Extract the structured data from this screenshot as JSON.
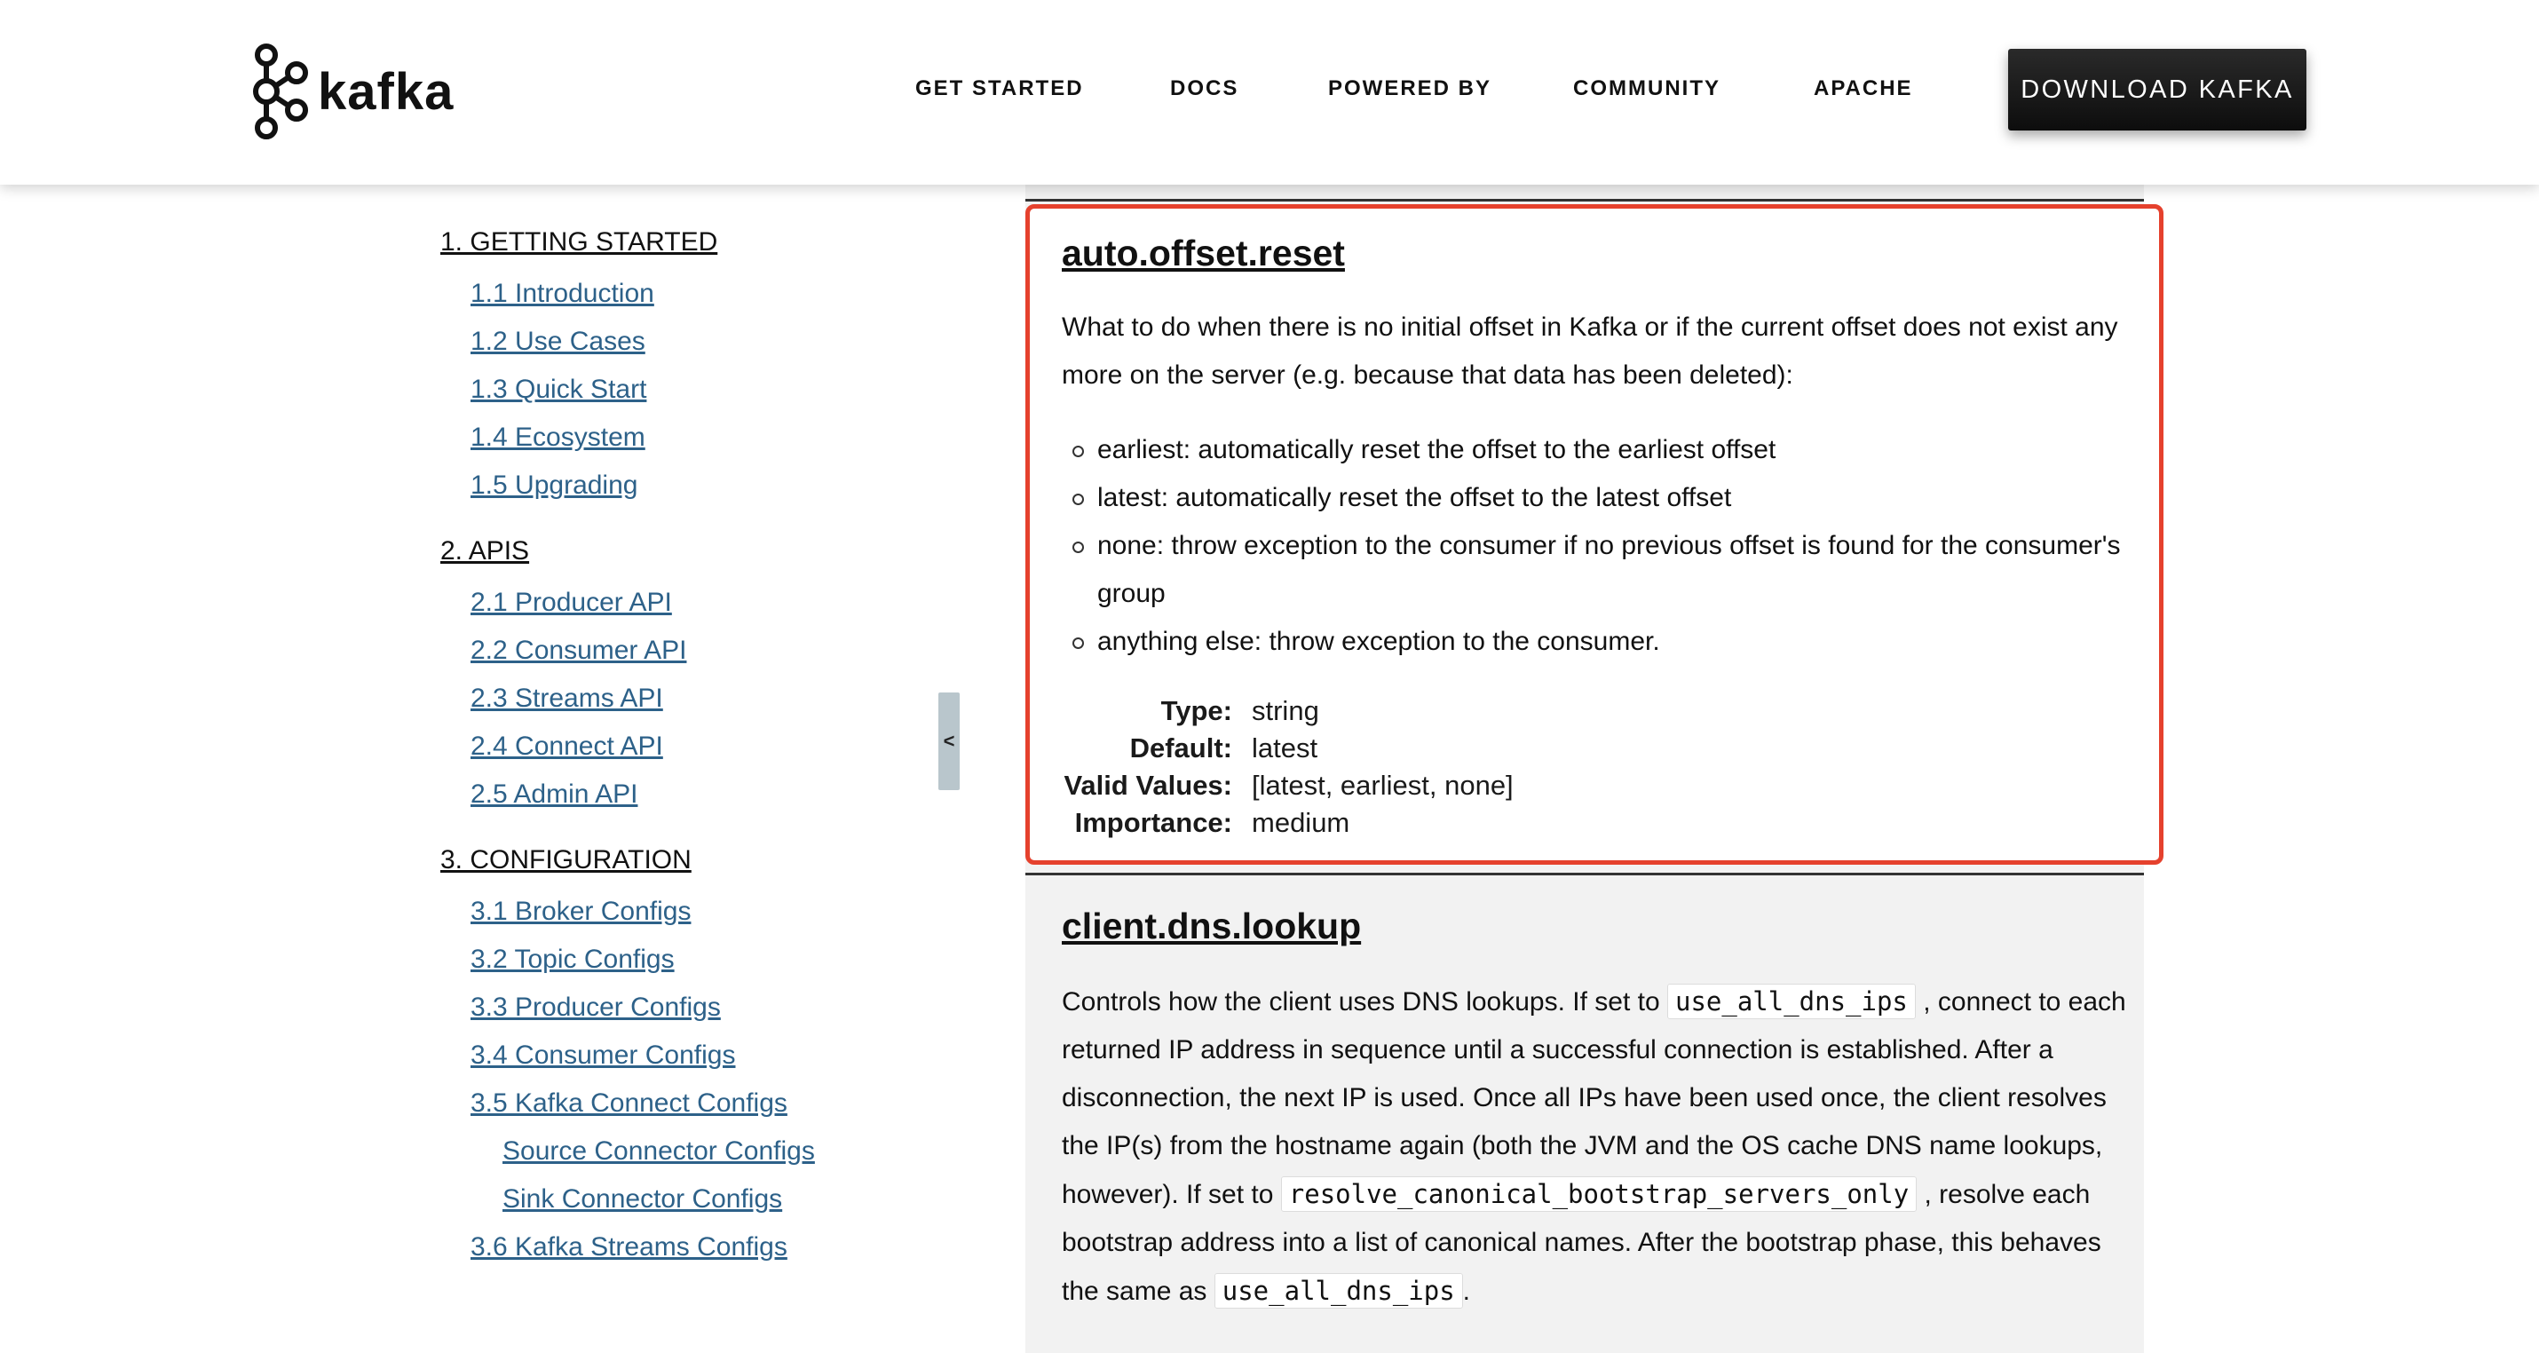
{
  "header": {
    "logo_text": "kafka",
    "nav": [
      "GET STARTED",
      "DOCS",
      "POWERED BY",
      "COMMUNITY",
      "APACHE"
    ],
    "download_label": "DOWNLOAD KAFKA"
  },
  "sidebar": {
    "sections": [
      {
        "label": "1. GETTING STARTED",
        "items": [
          "1.1 Introduction",
          "1.2 Use Cases",
          "1.3 Quick Start",
          "1.4 Ecosystem",
          "1.5 Upgrading"
        ]
      },
      {
        "label": "2. APIS",
        "items": [
          "2.1 Producer API",
          "2.2 Consumer API",
          "2.3 Streams API",
          "2.4 Connect API",
          "2.5 Admin API"
        ]
      },
      {
        "label": "3. CONFIGURATION",
        "items": [
          "3.1 Broker Configs",
          "3.2 Topic Configs",
          "3.3 Producer Configs",
          "3.4 Consumer Configs",
          "3.5 Kafka Connect Configs"
        ],
        "subitems": [
          "Source Connector Configs",
          "Sink Connector Configs"
        ],
        "after": [
          "3.6 Kafka Streams Configs"
        ]
      }
    ],
    "collapse_label": "<"
  },
  "configs": {
    "auto_offset_reset": {
      "title": "auto.offset.reset",
      "description_1": "What to do when there is no initial offset in Kafka or if the current offset does not exist any",
      "description_2": "more on the server (e.g. because that data has been deleted):",
      "bullets": [
        "earliest: automatically reset the offset to the earliest offset",
        "latest: automatically reset the offset to the latest offset",
        "none: throw exception to the consumer if no previous offset is found for the consumer's group",
        "anything else: throw exception to the consumer."
      ],
      "meta_keys": [
        "Type:",
        "Default:",
        "Valid Values:",
        "Importance:"
      ],
      "meta_values": [
        "string",
        "latest",
        "[latest, earliest, none]",
        "medium"
      ]
    },
    "client_dns_lookup": {
      "title": "client.dns.lookup",
      "p1_a": "Controls how the client uses DNS lookups. If set to",
      "code_1": "use_all_dns_ips",
      "p1_b": ", connect to each returned IP address in sequence until a successful connection is established. After a disconnection, the next IP is used. Once all IPs have been used once, the client resolves the IP(s) from the hostname again (both the JVM and the OS cache DNS name lookups, however). If set to",
      "code_2": "resolve_canonical_bootstrap_servers_only",
      "p1_c": ", resolve each bootstrap address into a list of canonical names. After the bootstrap phase, this behaves the same as",
      "code_3": "use_all_dns_ips",
      "p1_d": "."
    }
  }
}
